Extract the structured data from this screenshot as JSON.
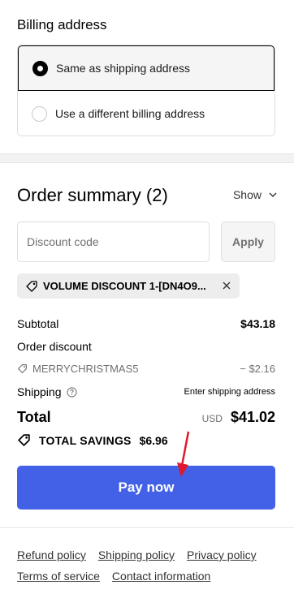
{
  "billing": {
    "title": "Billing address",
    "options": [
      {
        "label": "Same as shipping address",
        "selected": true
      },
      {
        "label": "Use a different billing address",
        "selected": false
      }
    ]
  },
  "summary": {
    "title": "Order summary (2)",
    "show_label": "Show",
    "discount_placeholder": "Discount code",
    "apply_label": "Apply",
    "applied_discount": "VOLUME DISCOUNT 1-[DN4O9...",
    "subtotal_label": "Subtotal",
    "subtotal_value": "$43.18",
    "order_discount_label": "Order discount",
    "discount_code_label": "MERRYCHRISTMAS5",
    "discount_code_value": "− $2.16",
    "shipping_label": "Shipping",
    "shipping_value": "Enter shipping address",
    "total_label": "Total",
    "currency": "USD",
    "total_value": "$41.02",
    "savings_label": "TOTAL SAVINGS",
    "savings_value": "$6.96",
    "pay_label": "Pay now"
  },
  "footer": {
    "links_row1": [
      "Refund policy",
      "Shipping policy",
      "Privacy policy"
    ],
    "links_row2": [
      "Terms of service",
      "Contact information"
    ]
  },
  "colors": {
    "accent": "#4361e6",
    "annotation_arrow": "#e0182d"
  },
  "icons": [
    "tag-icon",
    "close-icon",
    "chevron-down-icon",
    "help-icon",
    "savings-tag-icon"
  ]
}
